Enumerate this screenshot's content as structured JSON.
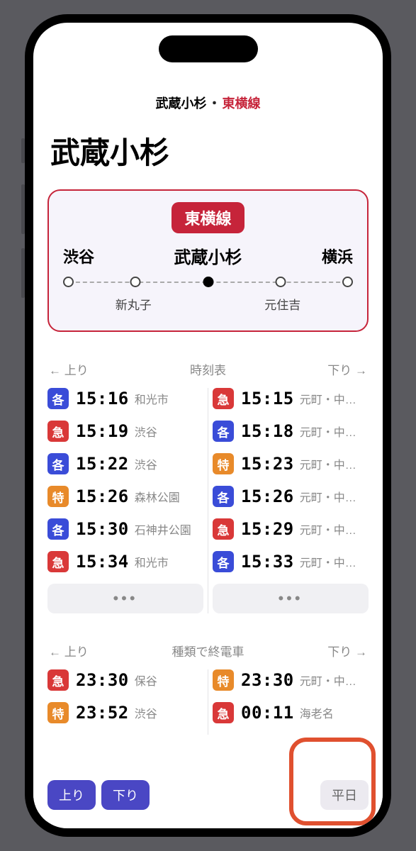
{
  "breadcrumb": {
    "station": "武蔵小杉",
    "sep": "・",
    "line": "東横線"
  },
  "title": "武蔵小杉",
  "line_card": {
    "badge": "東横線",
    "left": "渋谷",
    "center": "武蔵小杉",
    "right": "横浜",
    "sub1": "新丸子",
    "sub2": "元住吉"
  },
  "timetable": {
    "header": {
      "left_arrow": "←",
      "left": "上り",
      "center": "時刻表",
      "right": "下り",
      "right_arrow": "→"
    },
    "up": [
      {
        "type": "各",
        "cls": "kaku",
        "time": "15:16",
        "dest": "和光市"
      },
      {
        "type": "急",
        "cls": "kyu",
        "time": "15:19",
        "dest": "渋谷"
      },
      {
        "type": "各",
        "cls": "kaku",
        "time": "15:22",
        "dest": "渋谷"
      },
      {
        "type": "特",
        "cls": "toku",
        "time": "15:26",
        "dest": "森林公園"
      },
      {
        "type": "各",
        "cls": "kaku",
        "time": "15:30",
        "dest": "石神井公園"
      },
      {
        "type": "急",
        "cls": "kyu",
        "time": "15:34",
        "dest": "和光市"
      }
    ],
    "down": [
      {
        "type": "急",
        "cls": "kyu",
        "time": "15:15",
        "dest": "元町・中…"
      },
      {
        "type": "各",
        "cls": "kaku",
        "time": "15:18",
        "dest": "元町・中…"
      },
      {
        "type": "特",
        "cls": "toku",
        "time": "15:23",
        "dest": "元町・中…"
      },
      {
        "type": "各",
        "cls": "kaku",
        "time": "15:26",
        "dest": "元町・中…"
      },
      {
        "type": "急",
        "cls": "kyu",
        "time": "15:29",
        "dest": "元町・中…"
      },
      {
        "type": "各",
        "cls": "kaku",
        "time": "15:33",
        "dest": "元町・中…"
      }
    ]
  },
  "last_trains": {
    "header": {
      "left_arrow": "←",
      "left": "上り",
      "center": "種類で終電車",
      "right": "下り",
      "right_arrow": "→"
    },
    "up": [
      {
        "type": "急",
        "cls": "kyu",
        "time": "23:30",
        "dest": "保谷"
      },
      {
        "type": "特",
        "cls": "toku",
        "time": "23:52",
        "dest": "渋谷"
      }
    ],
    "down": [
      {
        "type": "特",
        "cls": "toku",
        "time": "23:30",
        "dest": "元町・中…"
      },
      {
        "type": "急",
        "cls": "kyu",
        "time": "00:11",
        "dest": "海老名"
      }
    ]
  },
  "bottom": {
    "up": "上り",
    "down": "下り",
    "day": "平日"
  },
  "ellipsis": "•••"
}
